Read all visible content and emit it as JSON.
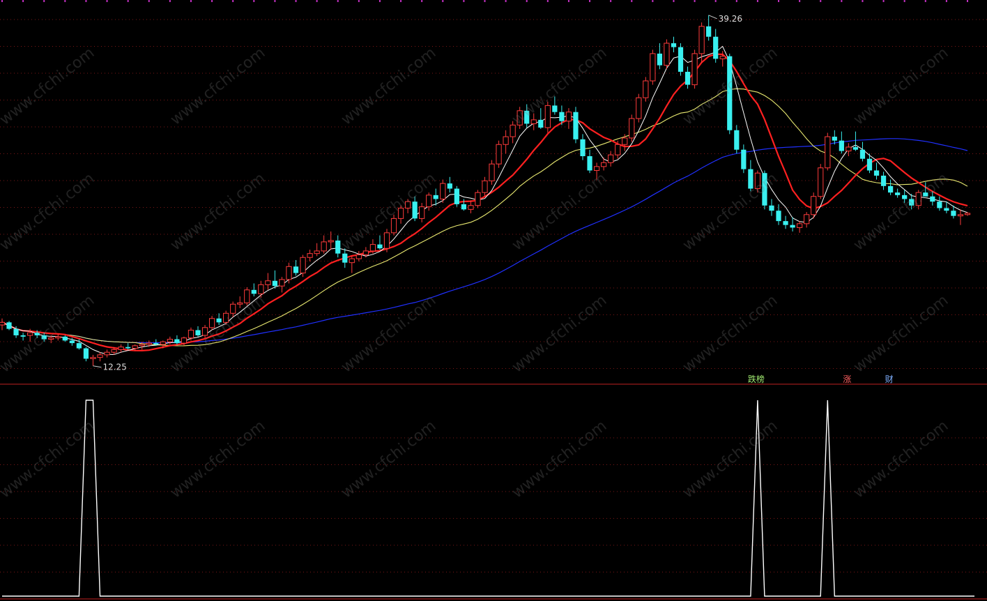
{
  "chart_data": [
    {
      "type": "candlestick",
      "title": "",
      "annotations": {
        "high_label": "39.26",
        "low_label": "12.25"
      },
      "colors": {
        "up": "#ff3b3b",
        "down": "#39f0f0",
        "ma_white": "#ffffff",
        "ma_red": "#ff2020",
        "ma_yellow": "#e8e870",
        "ma_blue": "#2030ff"
      },
      "ylim": [
        11,
        40
      ],
      "grid": true,
      "candles": [
        [
          15.4,
          15.9,
          15.0,
          15.6
        ],
        [
          15.6,
          15.7,
          15.0,
          15.1
        ],
        [
          15.1,
          15.3,
          14.4,
          14.6
        ],
        [
          14.6,
          14.8,
          14.2,
          14.5
        ],
        [
          14.6,
          15.1,
          14.1,
          14.8
        ],
        [
          14.8,
          15.0,
          14.4,
          14.6
        ],
        [
          14.6,
          14.8,
          14.1,
          14.3
        ],
        [
          14.3,
          14.6,
          14.0,
          14.4
        ],
        [
          14.4,
          14.7,
          14.2,
          14.5
        ],
        [
          14.5,
          14.6,
          14.1,
          14.2
        ],
        [
          14.2,
          14.4,
          13.8,
          14.0
        ],
        [
          14.0,
          14.3,
          13.5,
          13.6
        ],
        [
          13.6,
          13.7,
          12.6,
          12.8
        ],
        [
          12.8,
          13.1,
          12.25,
          12.9
        ],
        [
          12.9,
          13.3,
          12.6,
          13.1
        ],
        [
          13.1,
          13.5,
          12.9,
          13.3
        ],
        [
          13.3,
          13.7,
          13.1,
          13.5
        ],
        [
          13.5,
          13.9,
          13.3,
          13.7
        ],
        [
          13.7,
          14.0,
          13.5,
          13.6
        ],
        [
          13.6,
          13.9,
          13.4,
          13.8
        ],
        [
          13.8,
          14.1,
          13.5,
          13.9
        ],
        [
          13.9,
          14.2,
          13.7,
          14.0
        ],
        [
          14.0,
          14.3,
          13.8,
          13.9
        ],
        [
          13.9,
          14.2,
          13.6,
          14.1
        ],
        [
          14.1,
          14.5,
          13.9,
          14.3
        ],
        [
          14.3,
          14.6,
          13.9,
          14.0
        ],
        [
          14.0,
          14.5,
          13.8,
          14.4
        ],
        [
          14.4,
          15.2,
          14.2,
          15.0
        ],
        [
          15.0,
          15.3,
          14.5,
          14.6
        ],
        [
          14.6,
          15.4,
          14.4,
          15.2
        ],
        [
          15.2,
          16.1,
          15.0,
          15.9
        ],
        [
          15.9,
          16.3,
          15.4,
          15.6
        ],
        [
          15.6,
          16.5,
          15.4,
          16.3
        ],
        [
          16.3,
          17.2,
          16.0,
          17.0
        ],
        [
          17.0,
          17.6,
          16.7,
          17.1
        ],
        [
          17.1,
          18.3,
          16.9,
          18.1
        ],
        [
          18.1,
          18.6,
          17.6,
          17.8
        ],
        [
          17.8,
          18.8,
          17.5,
          18.5
        ],
        [
          18.5,
          19.4,
          18.1,
          18.8
        ],
        [
          18.8,
          19.6,
          18.2,
          18.4
        ],
        [
          18.4,
          19.1,
          17.9,
          18.9
        ],
        [
          18.9,
          20.2,
          18.6,
          19.9
        ],
        [
          19.9,
          20.4,
          19.2,
          19.4
        ],
        [
          19.4,
          20.8,
          19.1,
          20.6
        ],
        [
          20.6,
          21.2,
          20.3,
          20.9
        ],
        [
          20.9,
          21.7,
          20.7,
          21.1
        ],
        [
          21.1,
          22.3,
          20.9,
          21.8
        ],
        [
          21.8,
          22.6,
          21.2,
          21.9
        ],
        [
          21.9,
          22.3,
          20.6,
          20.9
        ],
        [
          20.9,
          21.3,
          19.8,
          20.2
        ],
        [
          20.2,
          20.7,
          19.4,
          20.5
        ],
        [
          20.5,
          21.1,
          20.3,
          20.8
        ],
        [
          20.8,
          21.4,
          20.6,
          21.1
        ],
        [
          21.1,
          22.0,
          20.9,
          21.6
        ],
        [
          21.6,
          22.3,
          21.2,
          21.3
        ],
        [
          21.3,
          22.8,
          21.0,
          22.5
        ],
        [
          22.5,
          23.9,
          22.3,
          23.6
        ],
        [
          23.6,
          24.6,
          23.2,
          24.4
        ],
        [
          24.4,
          25.1,
          24.0,
          24.9
        ],
        [
          24.9,
          25.3,
          23.4,
          23.6
        ],
        [
          23.6,
          24.8,
          23.3,
          24.5
        ],
        [
          24.5,
          25.6,
          24.2,
          25.4
        ],
        [
          25.4,
          25.9,
          24.6,
          25.1
        ],
        [
          25.1,
          26.6,
          24.8,
          26.3
        ],
        [
          26.3,
          26.8,
          25.6,
          25.9
        ],
        [
          25.9,
          26.1,
          24.5,
          24.7
        ],
        [
          24.7,
          25.1,
          24.2,
          24.3
        ],
        [
          24.3,
          25.0,
          24.0,
          24.6
        ],
        [
          24.6,
          25.8,
          24.4,
          25.6
        ],
        [
          25.6,
          26.8,
          25.3,
          26.5
        ],
        [
          26.5,
          28.1,
          26.2,
          27.8
        ],
        [
          27.8,
          29.6,
          27.5,
          29.3
        ],
        [
          29.3,
          30.4,
          28.6,
          29.9
        ],
        [
          29.9,
          31.1,
          29.4,
          30.8
        ],
        [
          30.8,
          32.2,
          30.5,
          31.9
        ],
        [
          31.9,
          32.4,
          30.6,
          30.9
        ],
        [
          30.9,
          31.7,
          30.4,
          31.2
        ],
        [
          31.2,
          32.1,
          30.5,
          30.6
        ],
        [
          30.6,
          32.6,
          30.2,
          32.3
        ],
        [
          32.3,
          33.0,
          31.6,
          31.8
        ],
        [
          31.8,
          32.3,
          30.8,
          31.1
        ],
        [
          31.1,
          32.1,
          30.5,
          31.8
        ],
        [
          31.8,
          32.2,
          29.4,
          29.7
        ],
        [
          29.7,
          30.1,
          28.1,
          28.4
        ],
        [
          28.4,
          28.9,
          27.1,
          27.3
        ],
        [
          27.3,
          27.9,
          26.6,
          27.6
        ],
        [
          27.6,
          28.3,
          27.3,
          27.9
        ],
        [
          27.9,
          28.8,
          27.6,
          28.5
        ],
        [
          28.5,
          29.6,
          28.2,
          29.3
        ],
        [
          29.3,
          30.1,
          28.8,
          29.8
        ],
        [
          29.8,
          31.6,
          29.5,
          31.3
        ],
        [
          31.3,
          33.2,
          31.0,
          32.9
        ],
        [
          32.9,
          34.5,
          32.6,
          34.2
        ],
        [
          34.2,
          36.6,
          33.9,
          36.3
        ],
        [
          36.3,
          37.1,
          35.1,
          35.4
        ],
        [
          35.4,
          37.4,
          35.1,
          37.1
        ],
        [
          37.1,
          37.6,
          36.4,
          36.8
        ],
        [
          36.8,
          37.1,
          34.6,
          34.9
        ],
        [
          34.9,
          35.3,
          33.6,
          33.9
        ],
        [
          33.9,
          36.6,
          33.6,
          36.3
        ],
        [
          36.3,
          38.7,
          35.6,
          38.4
        ],
        [
          38.4,
          39.26,
          37.3,
          37.6
        ],
        [
          37.6,
          38.2,
          35.6,
          35.9
        ],
        [
          35.9,
          36.5,
          35.3,
          36.1
        ],
        [
          36.1,
          36.3,
          30.1,
          30.4
        ],
        [
          30.4,
          30.8,
          28.6,
          28.9
        ],
        [
          28.9,
          29.3,
          27.1,
          27.4
        ],
        [
          27.4,
          28.1,
          25.7,
          25.9
        ],
        [
          25.9,
          27.3,
          25.6,
          27.1
        ],
        [
          27.1,
          27.3,
          24.3,
          24.6
        ],
        [
          24.6,
          25.1,
          23.8,
          24.2
        ],
        [
          24.2,
          24.7,
          23.1,
          23.4
        ],
        [
          23.4,
          23.8,
          22.8,
          23.1
        ],
        [
          23.1,
          23.7,
          22.6,
          22.9
        ],
        [
          22.9,
          23.4,
          22.5,
          23.2
        ],
        [
          23.2,
          24.1,
          22.9,
          23.9
        ],
        [
          23.9,
          25.6,
          23.6,
          25.3
        ],
        [
          25.3,
          27.8,
          25.1,
          27.5
        ],
        [
          27.5,
          30.2,
          27.3,
          29.9
        ],
        [
          29.9,
          30.4,
          29.3,
          29.6
        ],
        [
          29.6,
          30.3,
          28.6,
          28.8
        ],
        [
          28.8,
          29.4,
          28.4,
          29.1
        ],
        [
          29.1,
          30.3,
          28.8,
          28.9
        ],
        [
          28.9,
          29.5,
          28.0,
          28.2
        ],
        [
          28.2,
          28.6,
          27.1,
          27.3
        ],
        [
          27.3,
          27.9,
          26.6,
          26.9
        ],
        [
          26.9,
          27.2,
          25.8,
          26.1
        ],
        [
          26.1,
          26.6,
          25.4,
          25.6
        ],
        [
          25.6,
          25.9,
          25.2,
          25.4
        ],
        [
          25.4,
          25.8,
          24.8,
          25.1
        ],
        [
          25.1,
          25.5,
          24.3,
          24.6
        ],
        [
          24.6,
          25.8,
          24.3,
          25.6
        ],
        [
          25.6,
          26.4,
          25.3,
          25.3
        ],
        [
          25.3,
          25.7,
          24.6,
          24.9
        ],
        [
          24.9,
          25.3,
          24.2,
          24.4
        ],
        [
          24.4,
          24.9,
          24.0,
          24.2
        ],
        [
          24.2,
          24.6,
          23.6,
          23.8
        ],
        [
          23.8,
          24.3,
          23.1,
          23.9
        ],
        [
          23.9,
          24.1,
          23.8,
          24.0
        ]
      ]
    },
    {
      "type": "line",
      "title": "",
      "ylim": [
        0,
        1
      ],
      "color": "#ffffff",
      "values": [
        0,
        0,
        0,
        0,
        0,
        0,
        0,
        0,
        0,
        0,
        0,
        0,
        1,
        1,
        0,
        0,
        0,
        0,
        0,
        0,
        0,
        0,
        0,
        0,
        0,
        0,
        0,
        0,
        0,
        0,
        0,
        0,
        0,
        0,
        0,
        0,
        0,
        0,
        0,
        0,
        0,
        0,
        0,
        0,
        0,
        0,
        0,
        0,
        0,
        0,
        0,
        0,
        0,
        0,
        0,
        0,
        0,
        0,
        0,
        0,
        0,
        0,
        0,
        0,
        0,
        0,
        0,
        0,
        0,
        0,
        0,
        0,
        0,
        0,
        0,
        0,
        0,
        0,
        0,
        0,
        0,
        0,
        0,
        0,
        0,
        0,
        0,
        0,
        0,
        0,
        0,
        0,
        0,
        0,
        0,
        0,
        0,
        0,
        0,
        0,
        0,
        0,
        0,
        0,
        0,
        0,
        0,
        0,
        1,
        0,
        0,
        0,
        0,
        0,
        0,
        0,
        0,
        0,
        1,
        0,
        0,
        0,
        0,
        0,
        0,
        0,
        0,
        0,
        0,
        0,
        0,
        0,
        0,
        0,
        0,
        0,
        0,
        0,
        0,
        0
      ],
      "signals": [
        {
          "text": "跌榜",
          "index": 108,
          "color": "#9fe870"
        },
        {
          "text": "涨",
          "index": 121,
          "color": "#ff6060"
        },
        {
          "text": "财",
          "index": 127,
          "color": "#7fb0ff"
        }
      ]
    }
  ],
  "watermark": "www.cfchi.com",
  "colors": {
    "background": "#000000",
    "grid": "#8b1a1a",
    "divider": "#c02020",
    "top_marks": "#c030c0"
  }
}
